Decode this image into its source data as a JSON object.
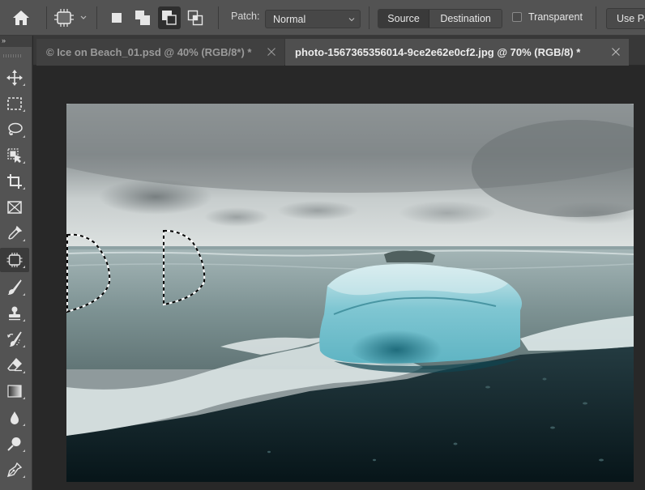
{
  "options_bar": {
    "home_icon": "home-icon",
    "tool_preset_icon": "patch-tool-icon",
    "selection_modes": [
      {
        "name": "new-selection",
        "icon": "new-selection-icon",
        "active": false
      },
      {
        "name": "add-to-selection",
        "icon": "add-selection-icon",
        "active": false
      },
      {
        "name": "subtract-from-selection",
        "icon": "subtract-selection-icon",
        "active": true
      },
      {
        "name": "intersect-with-selection",
        "icon": "intersect-selection-icon",
        "active": false
      }
    ],
    "patch_label": "Patch:",
    "patch_value": "Normal",
    "source_label": "Source",
    "destination_label": "Destination",
    "source_selected": true,
    "transparent_label": "Transparent",
    "transparent_checked": false,
    "use_pattern_label": "Use Pattern"
  },
  "toolbar": {
    "collapse_glyph": "»",
    "tools": [
      {
        "name": "move-tool",
        "icon": "move-icon",
        "active": false
      },
      {
        "name": "rectangular-marquee-tool",
        "icon": "marquee-icon",
        "active": false
      },
      {
        "name": "lasso-tool",
        "icon": "lasso-icon",
        "active": false
      },
      {
        "name": "object-selection-tool",
        "icon": "object-selection-icon",
        "active": false
      },
      {
        "name": "crop-tool",
        "icon": "crop-icon",
        "active": false
      },
      {
        "name": "frame-tool",
        "icon": "frame-icon",
        "active": false
      },
      {
        "name": "eyedropper-tool",
        "icon": "eyedropper-icon",
        "active": false
      },
      {
        "name": "patch-tool",
        "icon": "patch-icon",
        "active": true
      },
      {
        "name": "brush-tool",
        "icon": "brush-icon",
        "active": false
      },
      {
        "name": "clone-stamp-tool",
        "icon": "stamp-icon",
        "active": false
      },
      {
        "name": "history-brush-tool",
        "icon": "history-brush-icon",
        "active": false
      },
      {
        "name": "eraser-tool",
        "icon": "eraser-icon",
        "active": false
      },
      {
        "name": "gradient-tool",
        "icon": "gradient-icon",
        "active": false
      },
      {
        "name": "blur-tool",
        "icon": "blur-drop-icon",
        "active": false
      },
      {
        "name": "dodge-tool",
        "icon": "dodge-icon",
        "active": false
      },
      {
        "name": "pen-tool",
        "icon": "pen-icon",
        "active": false
      }
    ]
  },
  "tabs": [
    {
      "label": "© Ice on Beach_01.psd @ 40% (RGB/8*) *",
      "active": false
    },
    {
      "label": "photo-1567365356014-9ce2e62e0cf2.jpg @ 70% (RGB/8) *",
      "active": true
    }
  ],
  "document": {
    "description": "Photo of a turquoise iceberg on a black sand beach under a cloudy sky",
    "selections": 2
  }
}
